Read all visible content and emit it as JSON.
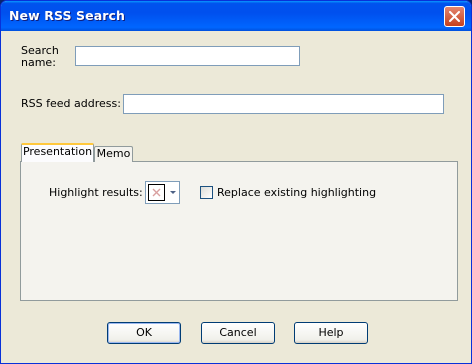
{
  "window": {
    "title": "New RSS Search"
  },
  "form": {
    "search_name_label": "Search\nname:",
    "search_name_value": "",
    "feed_address_label": "RSS feed address:",
    "feed_address_value": ""
  },
  "tabs": [
    {
      "label": "Presentation",
      "active": true
    },
    {
      "label": "Memo",
      "active": false
    }
  ],
  "presentation": {
    "highlight_label": "Highlight results:",
    "highlight_color": "none",
    "replace_label": "Replace existing highlighting",
    "replace_checked": false
  },
  "buttons": {
    "ok": "OK",
    "cancel": "Cancel",
    "help": "Help"
  },
  "colors": {
    "titlebar": "#0054e3",
    "dialog_bg": "#ece9d8",
    "tab_accent": "#ffc83c",
    "close_button": "#c5411e"
  }
}
